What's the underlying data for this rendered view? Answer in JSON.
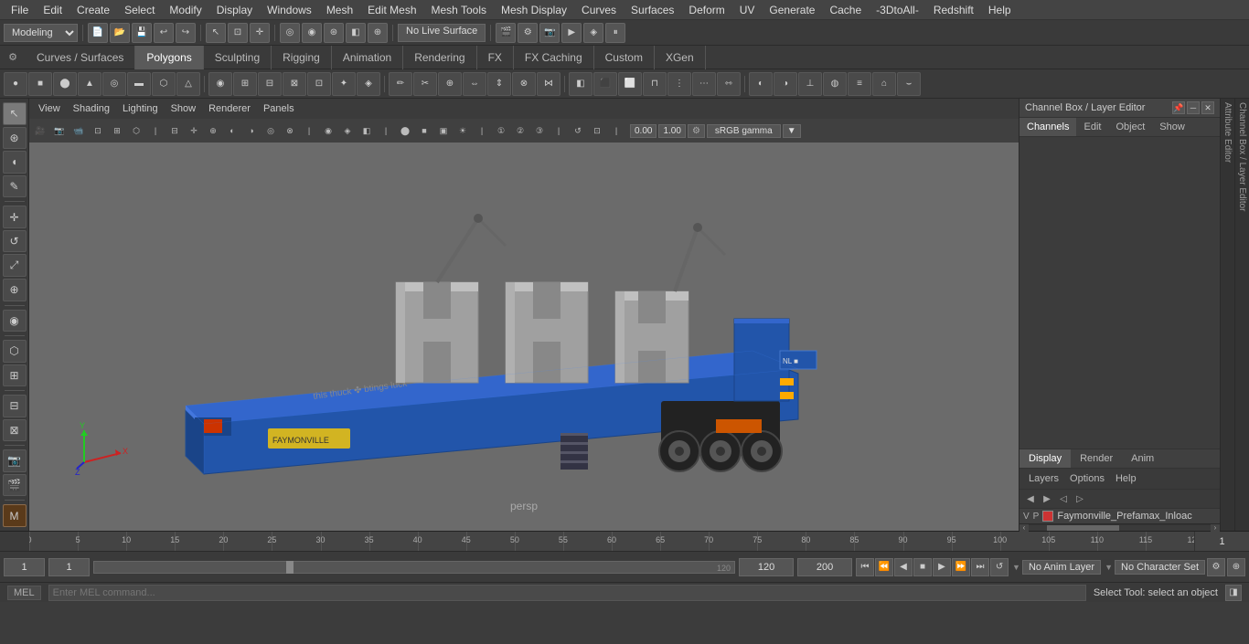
{
  "menubar": {
    "items": [
      "File",
      "Edit",
      "Create",
      "Select",
      "Modify",
      "Display",
      "Windows",
      "Mesh",
      "Edit Mesh",
      "Mesh Tools",
      "Mesh Display",
      "Curves",
      "Surfaces",
      "Deform",
      "UV",
      "Generate",
      "Cache",
      "-3DtoAll-",
      "Redshift",
      "Help"
    ]
  },
  "toolbar1": {
    "mode_label": "Modeling",
    "no_live_surface": "No Live Surface"
  },
  "tabs": {
    "items": [
      "Curves / Surfaces",
      "Polygons",
      "Sculpting",
      "Rigging",
      "Animation",
      "Rendering",
      "FX",
      "FX Caching",
      "Custom",
      "XGen"
    ],
    "active": "Polygons"
  },
  "viewport": {
    "menu_items": [
      "View",
      "Shading",
      "Lighting",
      "Show",
      "Renderer",
      "Panels"
    ],
    "label": "persp",
    "gamma_label": "sRGB gamma",
    "gamma_val1": "0.00",
    "gamma_val2": "1.00"
  },
  "channel_box": {
    "title": "Channel Box / Layer Editor",
    "tabs": [
      "Channels",
      "Edit",
      "Object",
      "Show"
    ]
  },
  "display_tabs": {
    "items": [
      "Display",
      "Render",
      "Anim"
    ],
    "active": "Display"
  },
  "layers": {
    "tabs": [
      "Layers",
      "Options",
      "Help"
    ],
    "layer_name": "Faymonville_Prefamax_Inloac",
    "layer_vp1": "V",
    "layer_vp2": "P"
  },
  "bottom": {
    "frame_start": "1",
    "frame_current1": "1",
    "frame_slider_val": "1",
    "frame_end_slider": "120",
    "frame_end": "120",
    "frame_max": "200",
    "anim_layer": "No Anim Layer",
    "char_set": "No Character Set"
  },
  "status": {
    "mel_label": "MEL",
    "status_text": "Select Tool: select an object"
  },
  "icons": {
    "sphere": "●",
    "cube": "■",
    "cylinder": "⬤",
    "arrow": "▶",
    "arrow_left": "◀",
    "arrow_right": "▶",
    "skip_back": "⏮",
    "skip_fwd": "⏭",
    "play": "▶",
    "play_back": "◀",
    "stop": "■",
    "settings": "⚙",
    "close": "✕",
    "minimize": "─",
    "plus": "+",
    "minus": "−",
    "grid": "⊞",
    "magnet": "⚲",
    "move": "✛",
    "rotate": "↺",
    "scale": "⤢",
    "select": "↖",
    "lasso": "⌖",
    "soft": "◉",
    "paint": "🖌",
    "script_editor": "◨",
    "chevron_right": "›",
    "chevron_left": "‹"
  },
  "right_labels": {
    "channel_box_label": "Channel Box / Layer Editor",
    "attribute_editor": "Attribute Editor"
  }
}
